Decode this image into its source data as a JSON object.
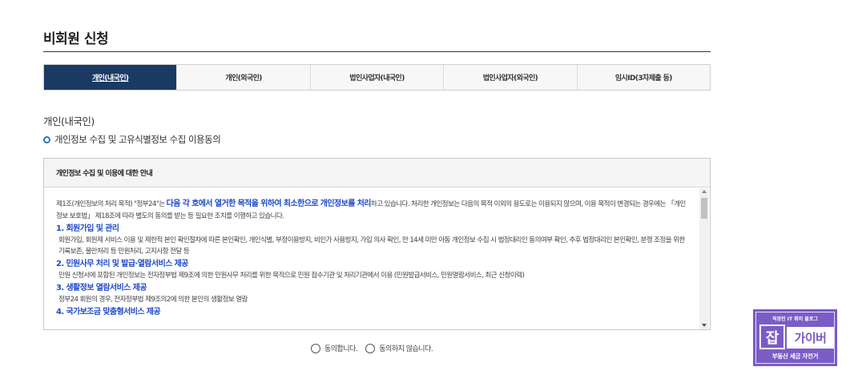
{
  "page": {
    "title": "비회원 신청"
  },
  "tabs": [
    {
      "label": "개인(내국인)",
      "active": true
    },
    {
      "label": "개인(외국인)",
      "active": false
    },
    {
      "label": "법인사업자(내국인)",
      "active": false
    },
    {
      "label": "법인사업자(외국인)",
      "active": false
    },
    {
      "label": "임시ID(3자제출 등)",
      "active": false
    }
  ],
  "section": {
    "label": "개인(내국인)",
    "consent_heading": "개인정보 수집 및 고유식별정보 수집 이용동의"
  },
  "notice": {
    "header": "개인정보 수집 및 이용에 대한 안내",
    "intro_pre": "제1조(개인정보의 처리 목적) \"정부24\"는 ",
    "intro_highlight": "다음 각 호에서 열거한 목적을 위하여 최소한으로 개인정보를 처리",
    "intro_post": "하고 있습니다. 처리한 개인정보는 다음의 목적 이외의 용도로는 이용되지 않으며, 이용 목적이 변경되는 경우에는 「개인정보 보호법」 제18조에 따라 별도의 동의를 받는 등 필요한 조치를 이행하고 있습니다.",
    "items": [
      {
        "heading": "1. 회원가입 및 관리",
        "text": "회원가입, 회원제 서비스 이용 및 제한적 본인 확인절차에 따른 본인확인, 개인식별, 부정이용방지, 비인가 사용방지, 가입 의사 확인, 만 14세 미만 아동 개인정보 수집 시 법정대리인 동의여부 확인, 추후 법정대리인 본인확인, 분쟁 조정을 위한 기록보존, 불만처리 등 민원처리, 고지사항 전달 등"
      },
      {
        "heading": "2. 민원사무 처리 및 발급·열람서비스 제공",
        "text": "민원 신청서에 포함된 개인정보는 전자정부법 제9조에 의한 민원사무 처리를 위한 목적으로 민원 접수기관 및 처리기관에서 이용 (민원발급서비스, 민원열람서비스, 최근 신청이력)"
      },
      {
        "heading": "3. 생활정보 열람서비스 제공",
        "text": "정부24 회원의 경우, 전자정부법 제9조의2에 의한 본인의 생활정보 열람"
      },
      {
        "heading": "4. 국가보조금 맞춤형서비스 제공",
        "text": ""
      }
    ]
  },
  "consent": {
    "agree_label": "동의합니다.",
    "disagree_label": "동의하지 않습니다."
  },
  "badge": {
    "top_text": "직장인 IT 취미 블로그",
    "jab": "잡",
    "guide": "가이버",
    "bottom_text": "부동산 세금 자전거"
  },
  "colors": {
    "active_tab": "#1a3a63",
    "highlight_blue": "#1f49c9",
    "badge_purple": "#7b5cc6"
  }
}
